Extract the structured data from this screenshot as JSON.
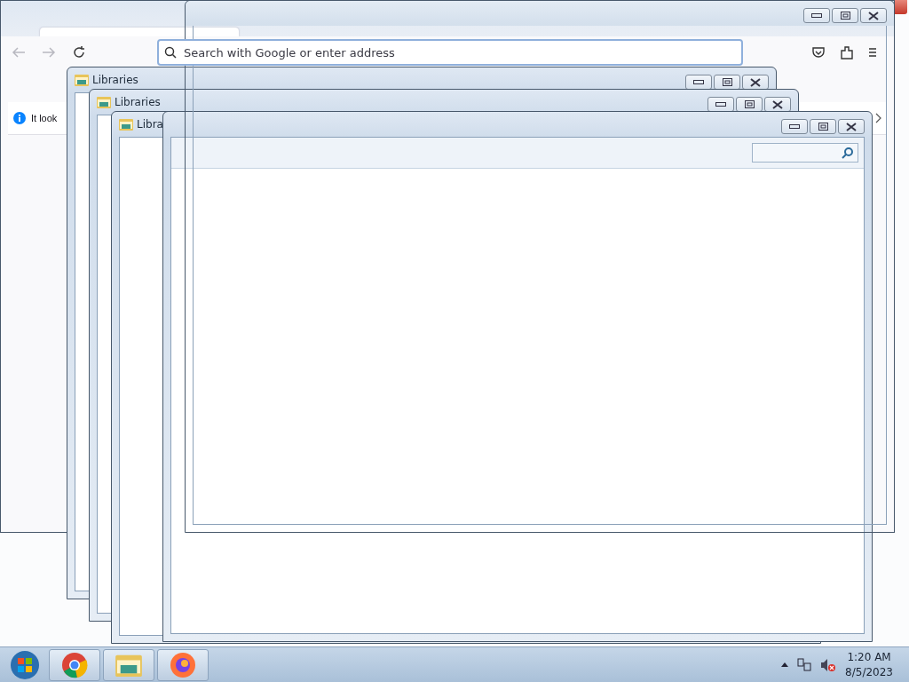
{
  "browser": {
    "address_placeholder": "Search with Google or enter address",
    "notification": "It look"
  },
  "windows": [
    {
      "kind": "explorer",
      "title": "Libraries"
    },
    {
      "kind": "explorer",
      "title": "Libraries"
    },
    {
      "kind": "explorer",
      "title": "Libra"
    },
    {
      "kind": "blank"
    },
    {
      "kind": "ghost"
    }
  ],
  "taskbar": {
    "apps": [
      {
        "kind": "chrome"
      },
      {
        "kind": "explorer"
      },
      {
        "kind": "firefox"
      }
    ],
    "time": "1:20 AM",
    "date": "8/5/2023"
  }
}
